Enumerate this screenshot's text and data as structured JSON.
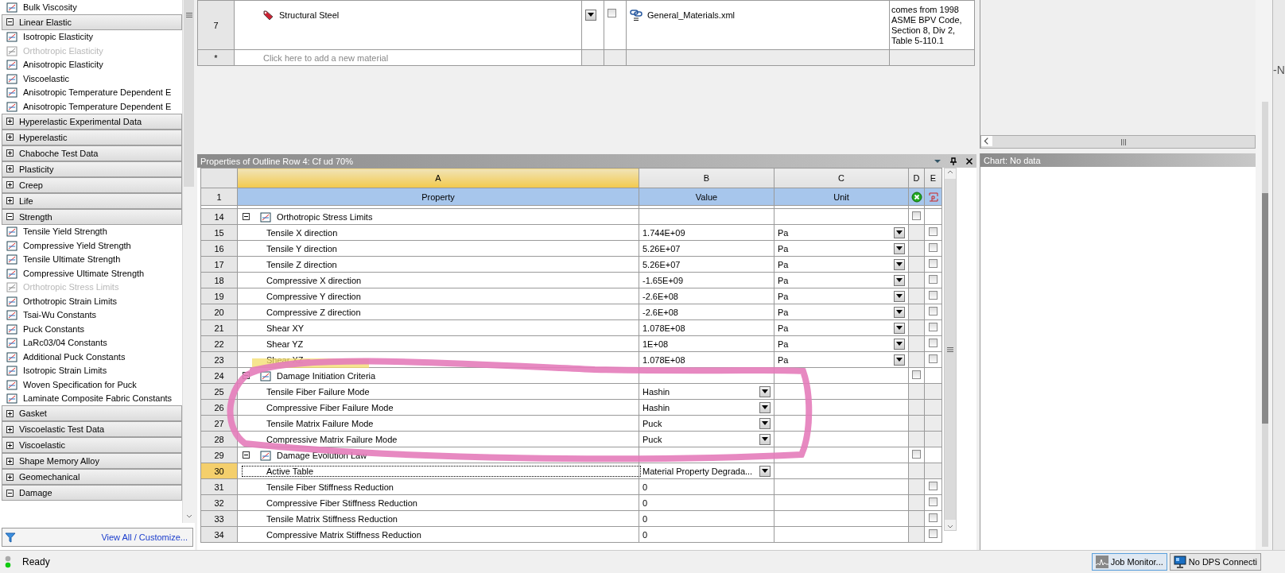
{
  "toolbox": {
    "leading_items": [
      {
        "label": "Bulk Viscosity",
        "disabled": false
      }
    ],
    "groups": [
      {
        "label": "Linear Elastic",
        "expanded": true,
        "children": [
          {
            "label": "Isotropic Elasticity",
            "disabled": false
          },
          {
            "label": "Orthotropic Elasticity",
            "disabled": true
          },
          {
            "label": "Anisotropic Elasticity",
            "disabled": false
          },
          {
            "label": "Viscoelastic",
            "disabled": false
          },
          {
            "label": "Anisotropic Temperature Dependent E",
            "disabled": false
          },
          {
            "label": "Anisotropic Temperature Dependent E",
            "disabled": false
          }
        ]
      },
      {
        "label": "Hyperelastic Experimental Data",
        "expanded": false
      },
      {
        "label": "Hyperelastic",
        "expanded": false
      },
      {
        "label": "Chaboche Test Data",
        "expanded": false
      },
      {
        "label": "Plasticity",
        "expanded": false
      },
      {
        "label": "Creep",
        "expanded": false
      },
      {
        "label": "Life",
        "expanded": false
      },
      {
        "label": "Strength",
        "expanded": true,
        "children": [
          {
            "label": "Tensile Yield Strength",
            "disabled": false
          },
          {
            "label": "Compressive Yield Strength",
            "disabled": false
          },
          {
            "label": "Tensile Ultimate Strength",
            "disabled": false
          },
          {
            "label": "Compressive Ultimate Strength",
            "disabled": false
          },
          {
            "label": "Orthotropic Stress Limits",
            "disabled": true
          },
          {
            "label": "Orthotropic Strain Limits",
            "disabled": false
          },
          {
            "label": "Tsai-Wu Constants",
            "disabled": false
          },
          {
            "label": "Puck Constants",
            "disabled": false
          },
          {
            "label": "LaRc03/04 Constants",
            "disabled": false
          },
          {
            "label": "Additional Puck Constants",
            "disabled": false
          },
          {
            "label": "Isotropic Strain Limits",
            "disabled": false
          },
          {
            "label": "Woven Specification for Puck",
            "disabled": false
          },
          {
            "label": "Laminate Composite Fabric Constants",
            "disabled": false
          }
        ]
      },
      {
        "label": "Gasket",
        "expanded": false
      },
      {
        "label": "Viscoelastic Test Data",
        "expanded": false
      },
      {
        "label": "Viscoelastic",
        "expanded": false
      },
      {
        "label": "Shape Memory Alloy",
        "expanded": false
      },
      {
        "label": "Geomechanical",
        "expanded": false
      },
      {
        "label": "Damage",
        "expanded": true
      }
    ],
    "footer_link": "View All / Customize..."
  },
  "materials_table": {
    "rows": [
      {
        "number": "7",
        "name": "Structural Steel",
        "checked": false,
        "source": "General_Materials.xml",
        "description": [
          "comes from 1998",
          "ASME BPV Code,",
          "Section 8, Div 2,",
          "Table 5-110.1"
        ]
      }
    ],
    "new_row": {
      "marker": "*",
      "placeholder": "Click here to add a new material"
    }
  },
  "properties": {
    "title": "Properties of Outline Row 4: Cf ud 70%",
    "columns": [
      {
        "letter": "A",
        "selected": true
      },
      {
        "letter": "B",
        "selected": false
      },
      {
        "letter": "C",
        "selected": false
      },
      {
        "letter": "D",
        "selected": false
      },
      {
        "letter": "E",
        "selected": false
      }
    ],
    "header": {
      "number": "1",
      "labels": [
        "Property",
        "Value",
        "Unit"
      ]
    },
    "rows": [
      {
        "number": "14",
        "kind": "group",
        "label": "Orthotropic Stress Limits",
        "expanded": true,
        "checked": false,
        "selected": false
      },
      {
        "number": "15",
        "kind": "value",
        "label": "Tensile X direction",
        "value": "1.744E+09",
        "unit": "Pa",
        "checked": false,
        "selected": false
      },
      {
        "number": "16",
        "kind": "value",
        "label": "Tensile Y direction",
        "value": "5.26E+07",
        "unit": "Pa",
        "checked": false,
        "selected": false
      },
      {
        "number": "17",
        "kind": "value",
        "label": "Tensile Z direction",
        "value": "5.26E+07",
        "unit": "Pa",
        "checked": false,
        "selected": false
      },
      {
        "number": "18",
        "kind": "value",
        "label": "Compressive X direction",
        "value": "-1.65E+09",
        "unit": "Pa",
        "checked": false,
        "selected": false
      },
      {
        "number": "19",
        "kind": "value",
        "label": "Compressive Y direction",
        "value": "-2.6E+08",
        "unit": "Pa",
        "checked": false,
        "selected": false
      },
      {
        "number": "20",
        "kind": "value",
        "label": "Compressive Z direction",
        "value": "-2.6E+08",
        "unit": "Pa",
        "checked": false,
        "selected": false
      },
      {
        "number": "21",
        "kind": "value",
        "label": "Shear XY",
        "value": "1.078E+08",
        "unit": "Pa",
        "checked": false,
        "selected": false
      },
      {
        "number": "22",
        "kind": "value",
        "label": "Shear YZ",
        "value": "1E+08",
        "unit": "Pa",
        "checked": false,
        "selected": false
      },
      {
        "number": "23",
        "kind": "value",
        "label": "Shear XZ",
        "value": "1.078E+08",
        "unit": "Pa",
        "checked": false,
        "selected": false
      },
      {
        "number": "24",
        "kind": "group",
        "label": "Damage Initiation Criteria",
        "expanded": true,
        "checked": false,
        "selected": false
      },
      {
        "number": "25",
        "kind": "choice",
        "label": "Tensile Fiber Failure Mode",
        "value": "Hashin",
        "selected": false
      },
      {
        "number": "26",
        "kind": "choice",
        "label": "Compressive Fiber Failure Mode",
        "value": "Hashin",
        "selected": false
      },
      {
        "number": "27",
        "kind": "choice",
        "label": "Tensile Matrix Failure Mode",
        "value": "Puck",
        "selected": false
      },
      {
        "number": "28",
        "kind": "choice",
        "label": "Compressive Matrix Failure Mode",
        "value": "Puck",
        "selected": false
      },
      {
        "number": "29",
        "kind": "group",
        "label": "Damage Evolution Law",
        "expanded": true,
        "checked": false,
        "selected": false
      },
      {
        "number": "30",
        "kind": "choice",
        "label": "Active Table",
        "value": "Material Property Degrada...",
        "selected": true
      },
      {
        "number": "31",
        "kind": "value",
        "label": "Tensile Fiber Stiffness Reduction",
        "value": "0",
        "checked": false,
        "selected": false
      },
      {
        "number": "32",
        "kind": "value",
        "label": "Compressive Fiber Stiffness Reduction",
        "value": "0",
        "checked": false,
        "selected": false
      },
      {
        "number": "33",
        "kind": "value",
        "label": "Tensile Matrix Stiffness Reduction",
        "value": "0",
        "checked": false,
        "selected": false
      },
      {
        "number": "34",
        "kind": "value",
        "label": "Compressive Matrix Stiffness Reduction",
        "value": "0",
        "checked": false,
        "selected": false
      }
    ]
  },
  "chart_panel": {
    "title": "Chart: No data"
  },
  "edge_fragment": "-N",
  "status_bar": {
    "text": "Ready",
    "buttons": [
      {
        "kind": "monitor",
        "label": "Job Monitor...",
        "selected": true
      },
      {
        "kind": "connection",
        "label": "No DPS Connecti",
        "selected": false
      }
    ]
  }
}
